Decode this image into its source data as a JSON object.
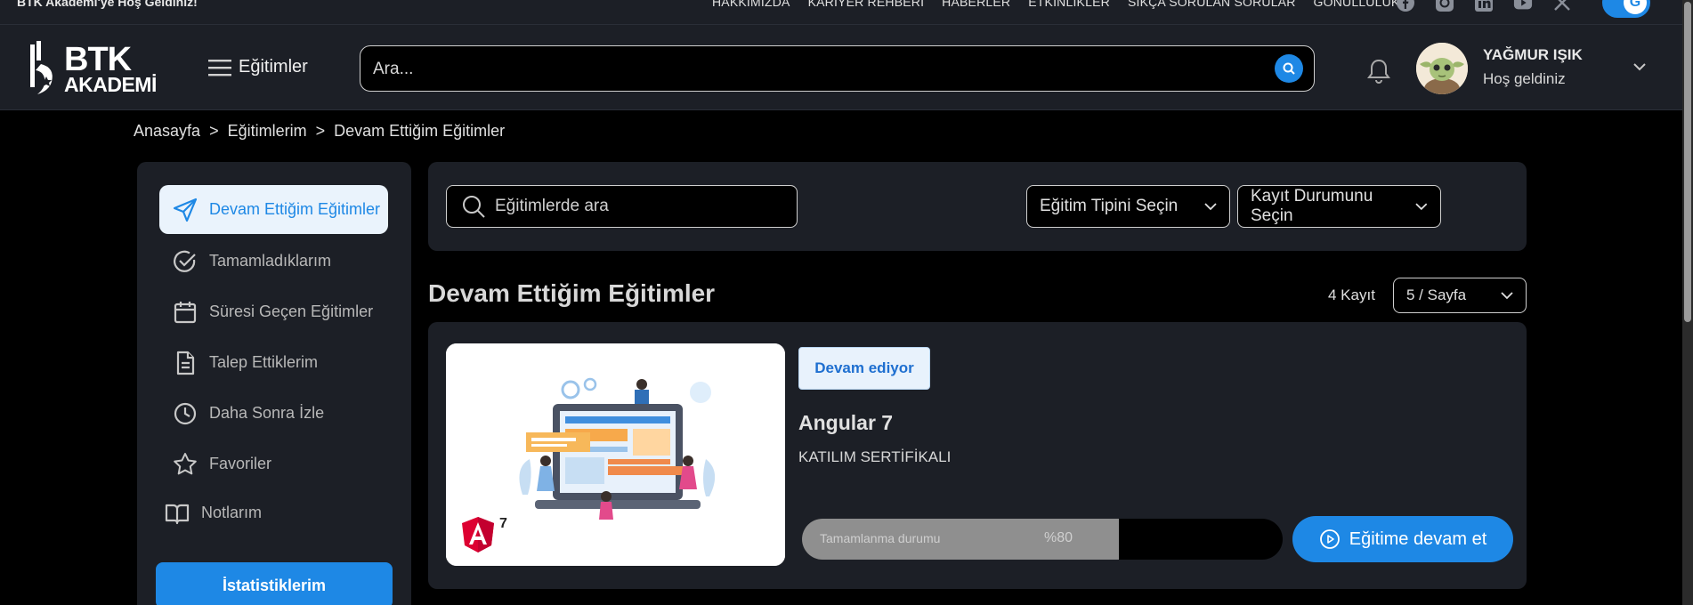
{
  "topbar": {
    "welcome": "BTK Akademi'ye Hoş Geldiniz!",
    "nav": [
      "HAKKIMIZDA",
      "KARİYER REHBERİ",
      "HABERLER",
      "ETKİNLİKLER",
      "SIKÇA SORULAN SORULAR",
      "GÖNÜLLÜLÜK"
    ],
    "social": [
      "facebook-icon",
      "instagram-icon",
      "linkedin-icon",
      "youtube-icon",
      "x-icon"
    ]
  },
  "header": {
    "logo_line1": "BTK",
    "logo_line2": "AKADEMİ",
    "menu_label": "Eğitimler",
    "search_placeholder": "Ara...",
    "user_name": "YAĞMUR IŞIK",
    "user_greeting": "Hoş geldiniz"
  },
  "breadcrumb": [
    "Anasayfa",
    ">",
    "Eğitimlerim",
    ">",
    "Devam Ettiğim Eğitimler"
  ],
  "sidebar": {
    "items": [
      {
        "label": "Devam Ettiğim Eğitimler",
        "icon": "send-icon",
        "active": true
      },
      {
        "label": "Tamamladıklarım",
        "icon": "check-circle-icon"
      },
      {
        "label": "Süresi Geçen Eğitimler",
        "icon": "calendar-icon"
      },
      {
        "label": "Talep Ettiklerim",
        "icon": "document-icon"
      },
      {
        "label": "Daha Sonra İzle",
        "icon": "clock-icon"
      },
      {
        "label": "Favoriler",
        "icon": "star-icon"
      },
      {
        "label": "Notlarım",
        "icon": "book-icon"
      }
    ],
    "stats_button": "İstatistiklerim"
  },
  "filters": {
    "search_placeholder": "Eğitimlerde ara",
    "type_select": "Eğitim Tipini Seçin",
    "status_select": "Kayıt Durumunu Seçin"
  },
  "section": {
    "title": "Devam Ettiğim Eğitimler",
    "count": "4 Kayıt",
    "page_size": "5 / Sayfa"
  },
  "course": {
    "status": "Devam ediyor",
    "title": "Angular 7",
    "subtitle": "KATILIM SERTİFİKALI",
    "progress_label": "Tamamlanma durumu",
    "progress_value": "%80",
    "progress_fraction": 0.66,
    "continue_label": "Eğitime devam et",
    "thumb_version": "7"
  },
  "colors": {
    "accent": "#1e88e5",
    "panel": "#1c1f26",
    "background": "#000000"
  }
}
